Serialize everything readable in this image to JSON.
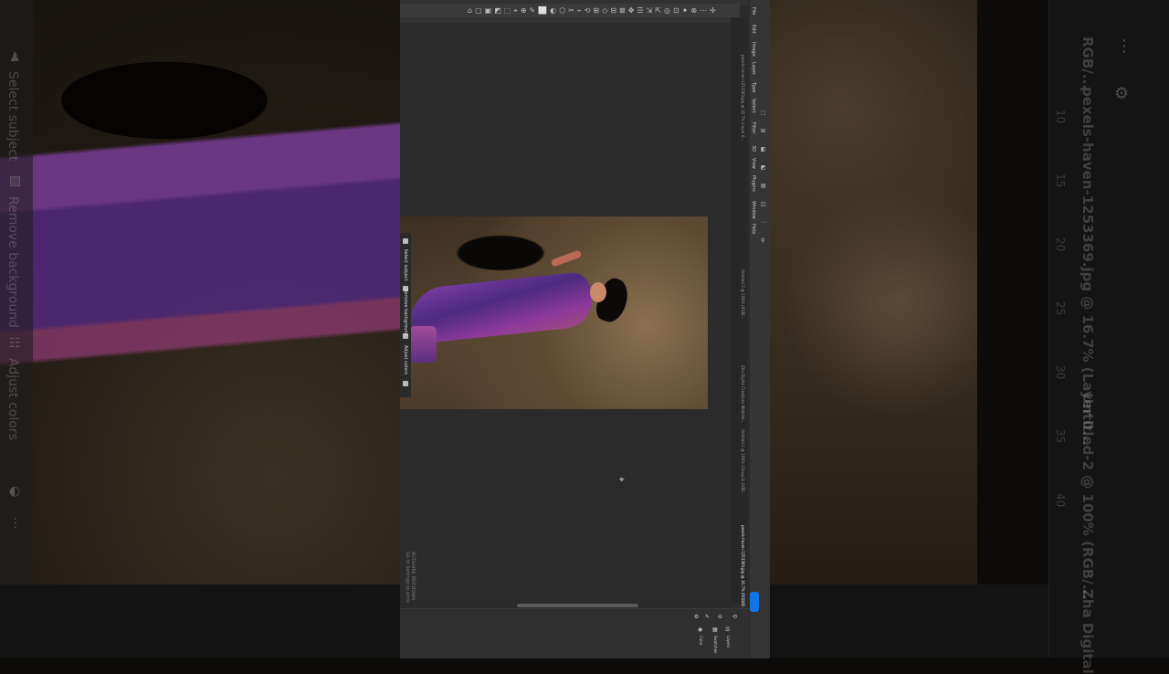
{
  "backdrop": {
    "left_panel": {
      "items": [
        {
          "icon": "person-icon",
          "label": "Select subject"
        },
        {
          "icon": "image-icon",
          "label": "Remove background"
        },
        {
          "icon": "sliders-icon",
          "label": "Adjust colors"
        }
      ]
    },
    "right_panel": {
      "doc_title_1": "pexels-haven-1253369.jpg @ 16.7% (Layer 0...",
      "doc_title_2": "Untitled-2 @ 100% (RGB/...",
      "doc_title_3": "Zha Digital",
      "header_fragment": "RGB/...",
      "ruler_numbers": [
        "10",
        "15",
        "20",
        "25",
        "30",
        "35",
        "40"
      ]
    }
  },
  "photoshop": {
    "menu": [
      "File",
      "Edit",
      "Image",
      "Layer",
      "Type",
      "Select",
      "Filter",
      "3D",
      "View",
      "Plugins",
      "Window",
      "Help"
    ],
    "tabs": [
      {
        "label": "pexels-haven-1253369.jpg @ 16.7% (Layer 0...",
        "active": false
      },
      {
        "label": "Untitled-2 @ 100% (RGB/...",
        "active": false
      },
      {
        "label": "Zha Digital Creations Website...",
        "active": false
      },
      {
        "label": "Untitled-1 @ 100% (Group 8, RGB...",
        "active": false
      },
      {
        "label": "pexels-haven-1253369.jpg @ 16.7% (RGB/8)",
        "active": true
      }
    ],
    "contextual_taskbar": {
      "select_subject": "Select subject",
      "remove_background": "Remove background",
      "adjust_colors": "Adjust colors"
    },
    "watermark": {
      "title": "Activate Windows",
      "subtitle": "Go to Settings to activate Windows."
    },
    "share_button": "Share",
    "panels": [
      "Color",
      "Swatches",
      "Layers"
    ],
    "tool_glyphs": [
      "⌂",
      "▢",
      "▣",
      "◩",
      "⬚",
      "⌖",
      "⊕",
      "✎",
      "⬜",
      "◐",
      "⬡",
      "✂",
      "⌁",
      "⟲",
      "⊞",
      "◇",
      "⊟",
      "⊠",
      "✥",
      "☰",
      "⇲",
      "⇱",
      "◎",
      "⊡",
      "✦",
      "⊗",
      "⋯",
      "✢"
    ]
  },
  "colors": {
    "accent": "#1473e6",
    "ui_bg": "#2b2b2b",
    "saree_purple": "#6b3a98"
  }
}
